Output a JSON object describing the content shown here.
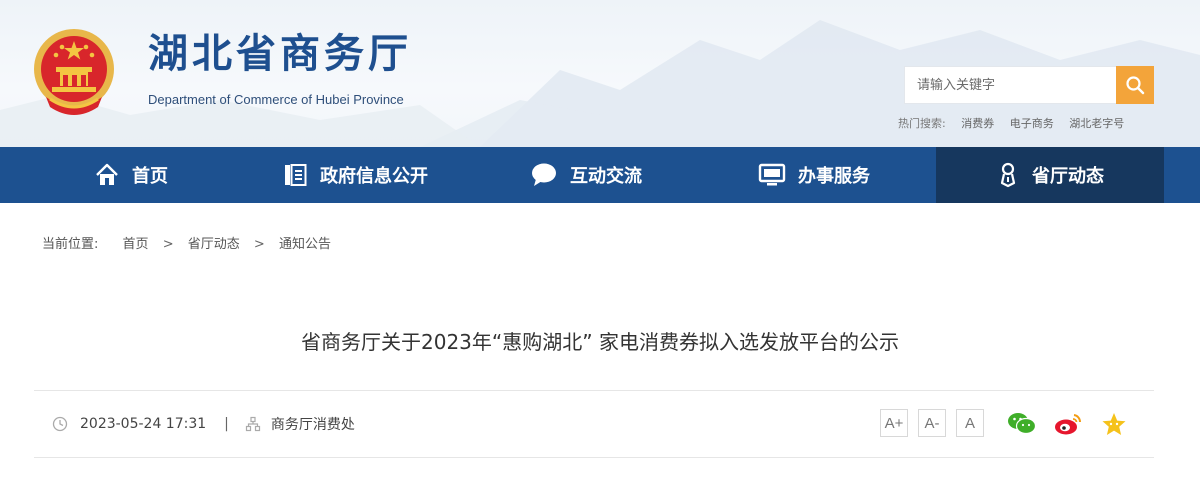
{
  "header": {
    "site_title": "湖北省商务厅",
    "site_subtitle": "Department of Commerce of Hubei Province",
    "search": {
      "placeholder": "请输入关键字"
    },
    "hot_search": {
      "label": "热门搜索:",
      "keywords": [
        "消费券",
        "电子商务",
        "湖北老字号"
      ]
    }
  },
  "nav": {
    "items": [
      {
        "label": "首页",
        "icon": "home-icon"
      },
      {
        "label": "政府信息公开",
        "icon": "document-icon"
      },
      {
        "label": "互动交流",
        "icon": "chat-bubble-icon"
      },
      {
        "label": "办事服务",
        "icon": "monitor-icon"
      },
      {
        "label": "省厅动态",
        "icon": "person-badge-icon",
        "active": true
      }
    ]
  },
  "breadcrumb": {
    "label": "当前位置:",
    "items": [
      "首页",
      "省厅动态",
      "通知公告"
    ],
    "separator": ">"
  },
  "article": {
    "title": "省商务厅关于2023年“惠购湖北” 家电消费券拟入选发放平台的公示",
    "datetime": "2023-05-24 17:31",
    "separator": "|",
    "source": "商务厅消费处"
  },
  "font_size_buttons": [
    "A+",
    "A-",
    "A"
  ],
  "share": [
    "wechat-icon",
    "weibo-icon",
    "favorite-star-icon"
  ],
  "colors": {
    "nav_bg": "#1d5190",
    "nav_active_bg": "#16375e",
    "title_blue": "#1e4f8f",
    "search_btn": "#f3a43a"
  }
}
